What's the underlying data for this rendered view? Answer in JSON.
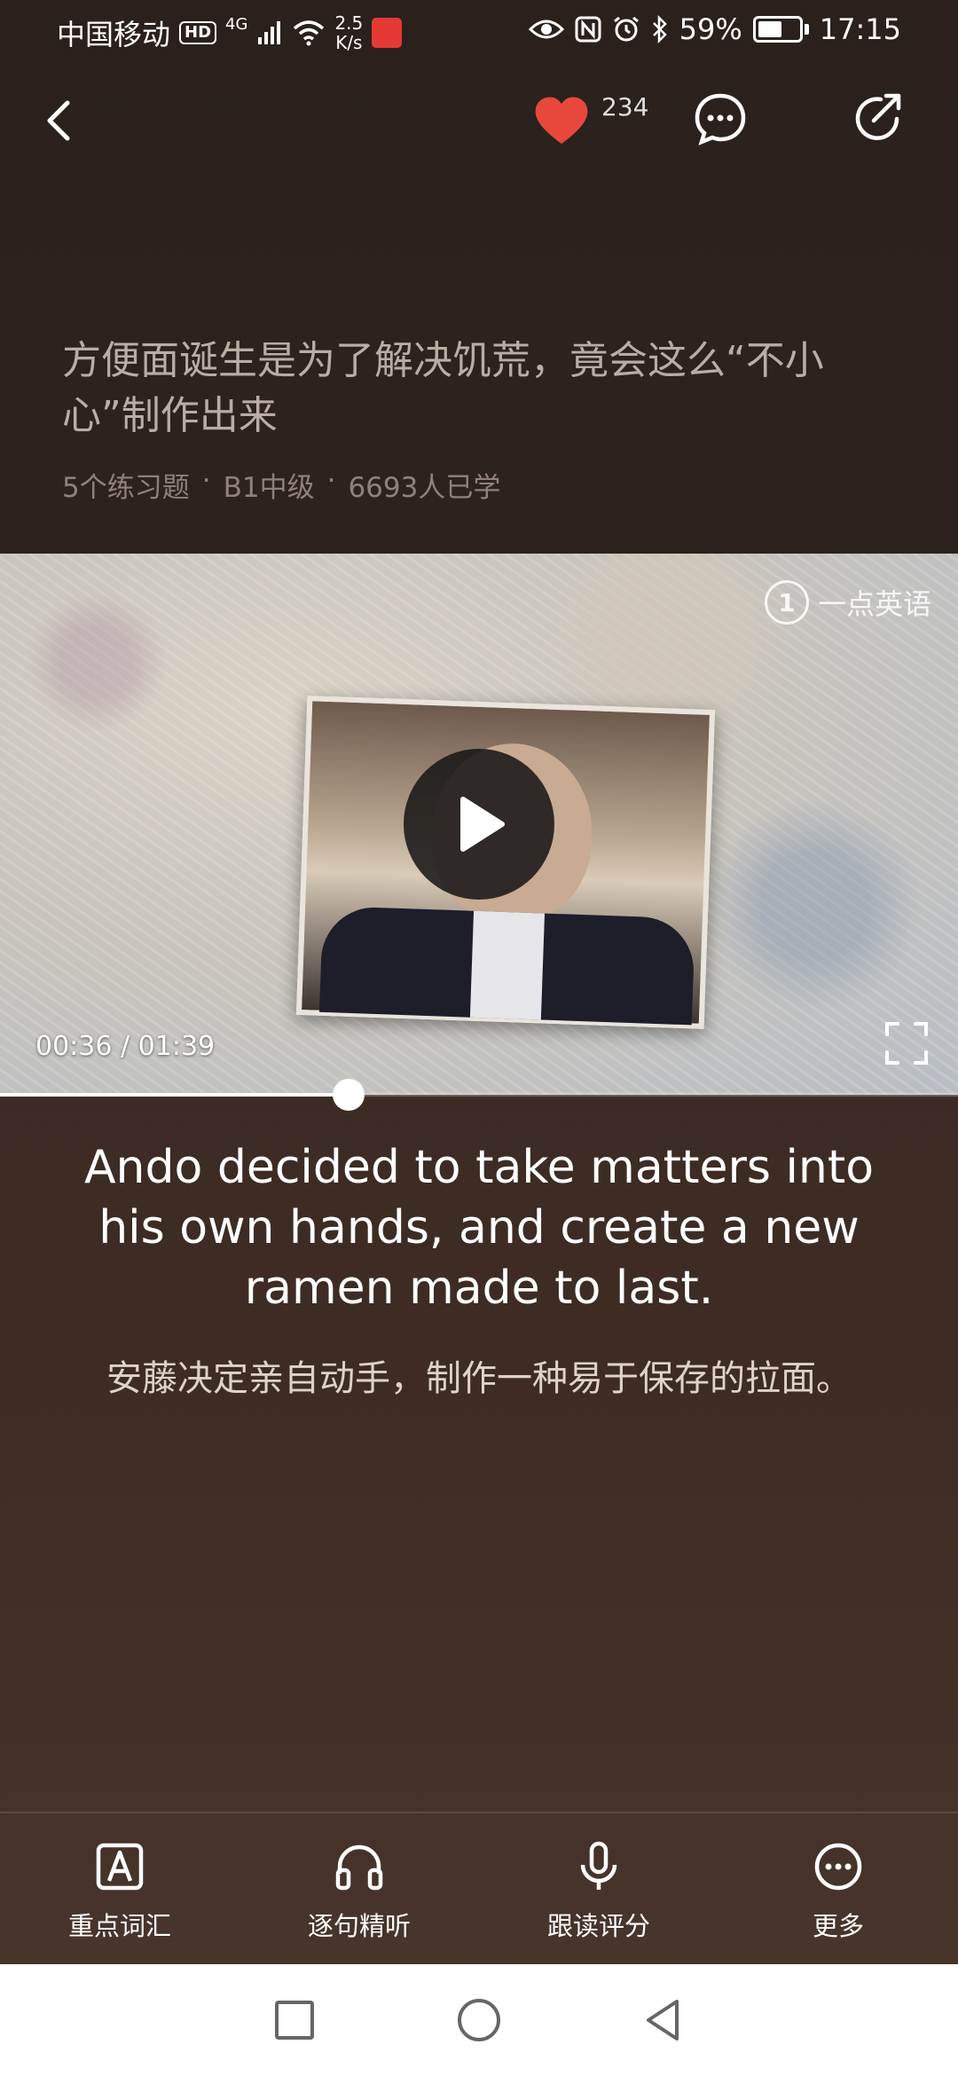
{
  "status_bar": {
    "carrier": "中国移动",
    "hd": "HD",
    "network": "4G",
    "speed_value": "2.5",
    "speed_unit": "K/s",
    "battery": "59%",
    "time": "17:15"
  },
  "nav": {
    "like_count": "234"
  },
  "article": {
    "title": "方便面诞生是为了解决饥荒，竟会这么“不小心”制作出来",
    "exercises": "5个练习题",
    "level": "B1中级",
    "learners": "6693人已学"
  },
  "video": {
    "watermark": "一点英语",
    "current_time": "00:36",
    "total_time": "01:39",
    "progress_fraction": 0.3636
  },
  "subtitles": {
    "english": "Ando decided to take matters into his own hands, and create a new ramen made to last.",
    "chinese": "安藤决定亲自动手，制作一种易于保存的拉面。"
  },
  "toolbar": {
    "items": [
      {
        "label": "重点词汇",
        "icon": "vocabulary-icon"
      },
      {
        "label": "逐句精听",
        "icon": "headphones-icon"
      },
      {
        "label": "跟读评分",
        "icon": "microphone-icon"
      },
      {
        "label": "更多",
        "icon": "more-icon"
      }
    ]
  },
  "colors": {
    "like": "#e8473c",
    "background": "#2a211d"
  }
}
